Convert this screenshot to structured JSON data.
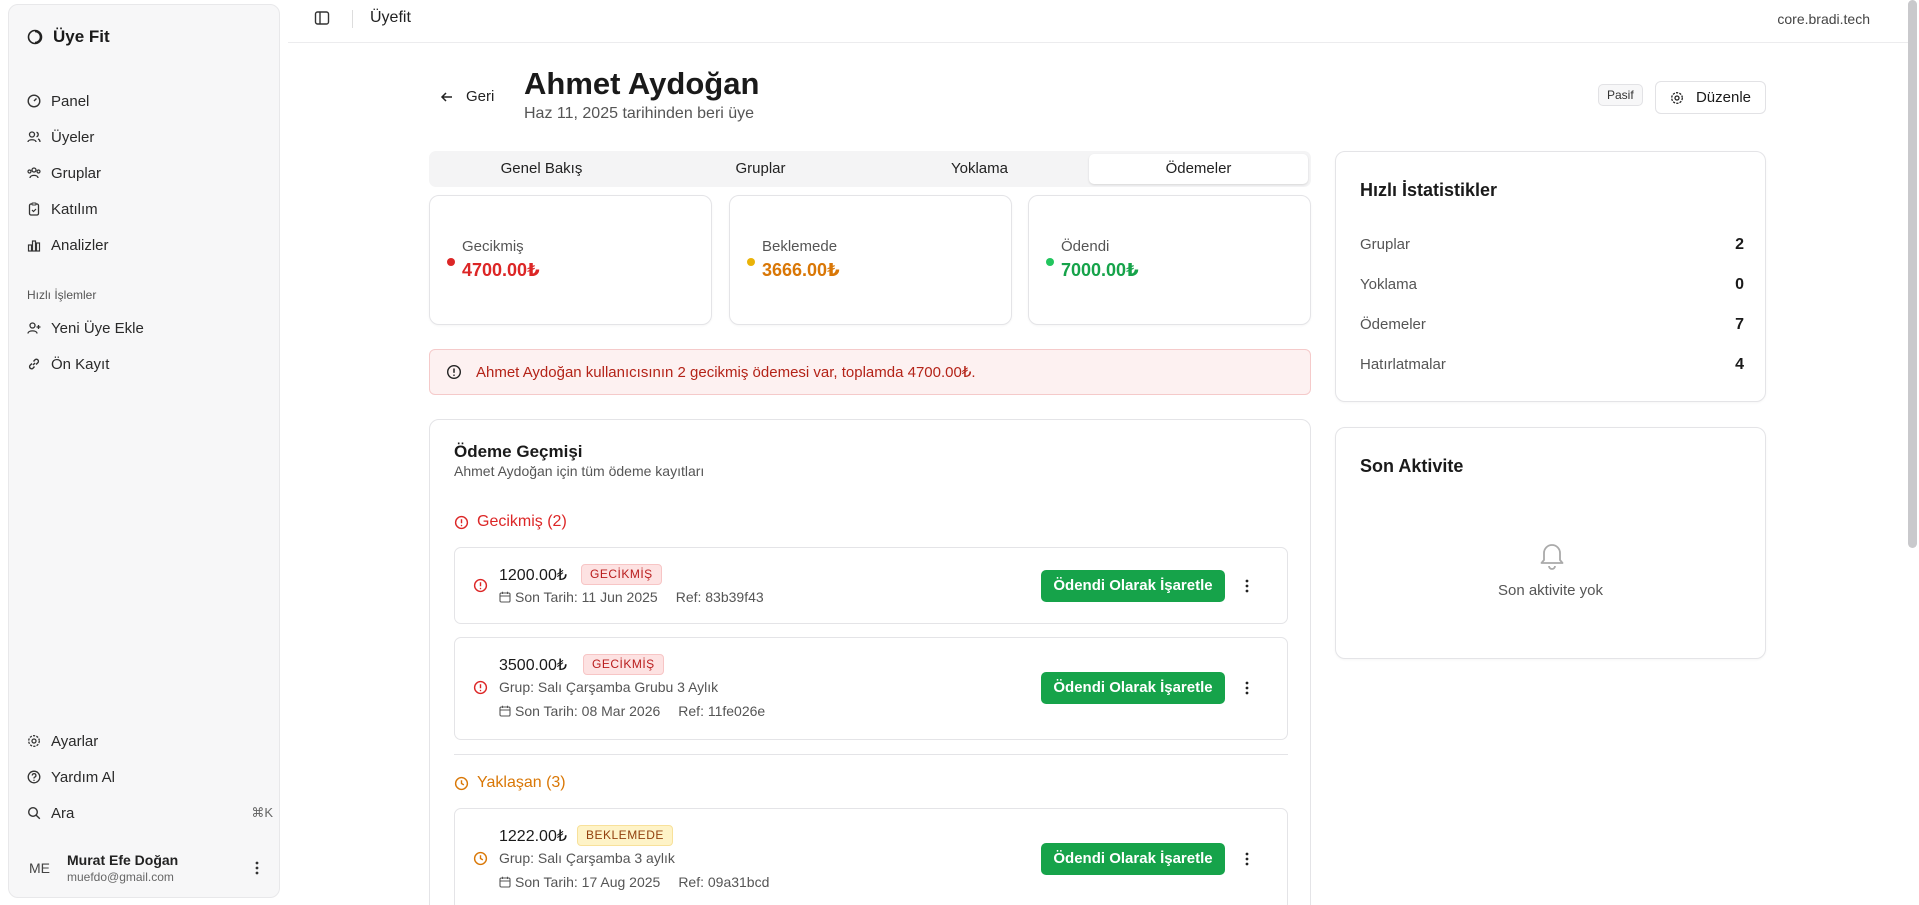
{
  "sidebar": {
    "brand": "Üye Fit",
    "nav": [
      {
        "label": "Panel",
        "icon": "gauge-icon"
      },
      {
        "label": "Üyeler",
        "icon": "users-icon"
      },
      {
        "label": "Gruplar",
        "icon": "group-icon"
      },
      {
        "label": "Katılım",
        "icon": "clipboard-icon"
      },
      {
        "label": "Analizler",
        "icon": "bar-chart-icon"
      }
    ],
    "quick_section": "Hızlı İşlemler",
    "quick": [
      {
        "label": "Yeni Üye Ekle",
        "icon": "user-plus-icon"
      },
      {
        "label": "Ön Kayıt",
        "icon": "link-icon"
      }
    ],
    "bottom": [
      {
        "label": "Ayarlar",
        "icon": "gear-icon"
      },
      {
        "label": "Yardım Al",
        "icon": "help-circle-icon"
      },
      {
        "label": "Ara",
        "icon": "search-icon",
        "shortcut": "⌘K"
      }
    ],
    "user": {
      "initials": "ME",
      "name": "Murat Efe Doğan",
      "email": "muefdo@gmail.com"
    }
  },
  "topbar": {
    "title": "Üyefit",
    "domain": "core.bradi.tech"
  },
  "header": {
    "back_label": "Geri",
    "member_name": "Ahmet Aydoğan",
    "member_since": "Haz 11, 2025 tarihinden beri üye",
    "status_badge": "Pasif",
    "edit_label": "Düzenle"
  },
  "tabs": [
    "Genel Bakış",
    "Gruplar",
    "Yoklama",
    "Ödemeler"
  ],
  "active_tab": "Ödemeler",
  "stats": [
    {
      "label": "Gecikmiş",
      "value": "4700.00₺",
      "color": "#dc2626"
    },
    {
      "label": "Beklemede",
      "value": "3666.00₺",
      "color": "#d97706"
    },
    {
      "label": "Ödendi",
      "value": "7000.00₺",
      "color": "#16a34a"
    }
  ],
  "alert": "Ahmet Aydoğan kullanıcısının 2 gecikmiş ödemesi var, toplamda 4700.00₺.",
  "history": {
    "title": "Ödeme Geçmişi",
    "subtitle": "Ahmet Aydoğan için tüm ödeme kayıtları",
    "overdue_heading": "Gecikmiş (2)",
    "upcoming_heading": "Yaklaşan (3)",
    "mark_paid_label": "Ödendi Olarak İşaretle",
    "payments": [
      {
        "amount": "1200.00₺",
        "status": "GECİKMİŞ",
        "group": "",
        "due": "Son Tarih: 11 Jun 2025",
        "ref": "Ref: 83b39f43"
      },
      {
        "amount": "3500.00₺",
        "status": "GECİKMİŞ",
        "group": "Grup: Salı Çarşamba Grubu 3 Aylık",
        "due": "Son Tarih: 08 Mar 2026",
        "ref": "Ref: 11fe026e"
      },
      {
        "amount": "1222.00₺",
        "status": "BEKLEMEDE",
        "group": "Grup: Salı Çarşamba 3 aylık",
        "due": "Son Tarih: 17 Aug 2025",
        "ref": "Ref: 09a31bcd"
      }
    ]
  },
  "quick_stats": {
    "title": "Hızlı İstatistikler",
    "rows": [
      {
        "label": "Gruplar",
        "value": "2"
      },
      {
        "label": "Yoklama",
        "value": "0"
      },
      {
        "label": "Ödemeler",
        "value": "7"
      },
      {
        "label": "Hatırlatmalar",
        "value": "4"
      }
    ]
  },
  "activity": {
    "title": "Son Aktivite",
    "empty": "Son aktivite yok"
  },
  "colors": {
    "overdue": "#dc2626",
    "pending": "#d97706",
    "paid": "#16a34a",
    "accent_button": "#16a34a"
  }
}
